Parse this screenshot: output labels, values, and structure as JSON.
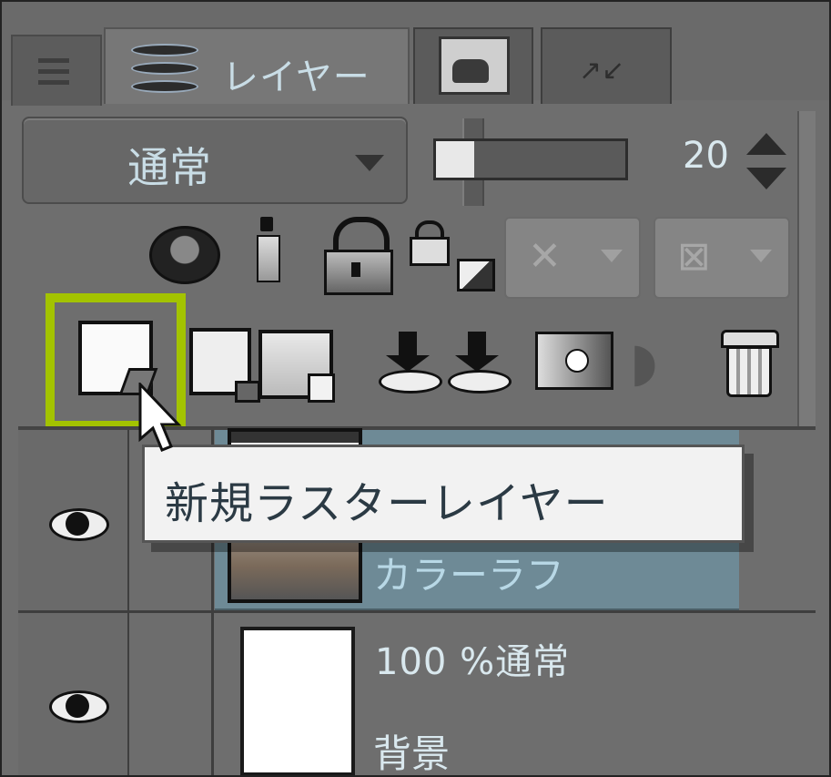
{
  "tabs": [
    {
      "label": "",
      "icon": "panel-menu-icon"
    },
    {
      "label": "レイヤー",
      "icon": "layer-stack-icon",
      "active": true
    },
    {
      "label": "",
      "icon": "image-preview-icon"
    },
    {
      "label": "",
      "icon": "move-arrows-icon"
    }
  ],
  "blend_mode": {
    "value": "通常"
  },
  "opacity": {
    "value": "20",
    "fraction": 0.2
  },
  "toolbar_row1": [
    "clipping-icon",
    "reference-layer-icon",
    "lock-layer-icon",
    "lock-transparent-pixels-icon",
    "masking-dropdown-icon",
    "ruler-dropdown-icon"
  ],
  "toolbar_row2": [
    "new-raster-layer-icon",
    "new-vector-layer-icon",
    "new-layer-folder-icon",
    "transfer-down-icon",
    "merge-down-icon",
    "layer-mask-icon",
    "ruler-icon",
    "delete-layer-icon"
  ],
  "tooltip": {
    "text": "新規ラスターレイヤー"
  },
  "layers": [
    {
      "name": "カラーラフ",
      "visible": true,
      "selected": true
    },
    {
      "meta": "100 %通常",
      "name": "背景",
      "visible": true,
      "selected": false
    }
  ],
  "colors": {
    "highlight": "#a3c300",
    "panel": "#6e6e6e",
    "selected_row": "#6e8a96"
  }
}
